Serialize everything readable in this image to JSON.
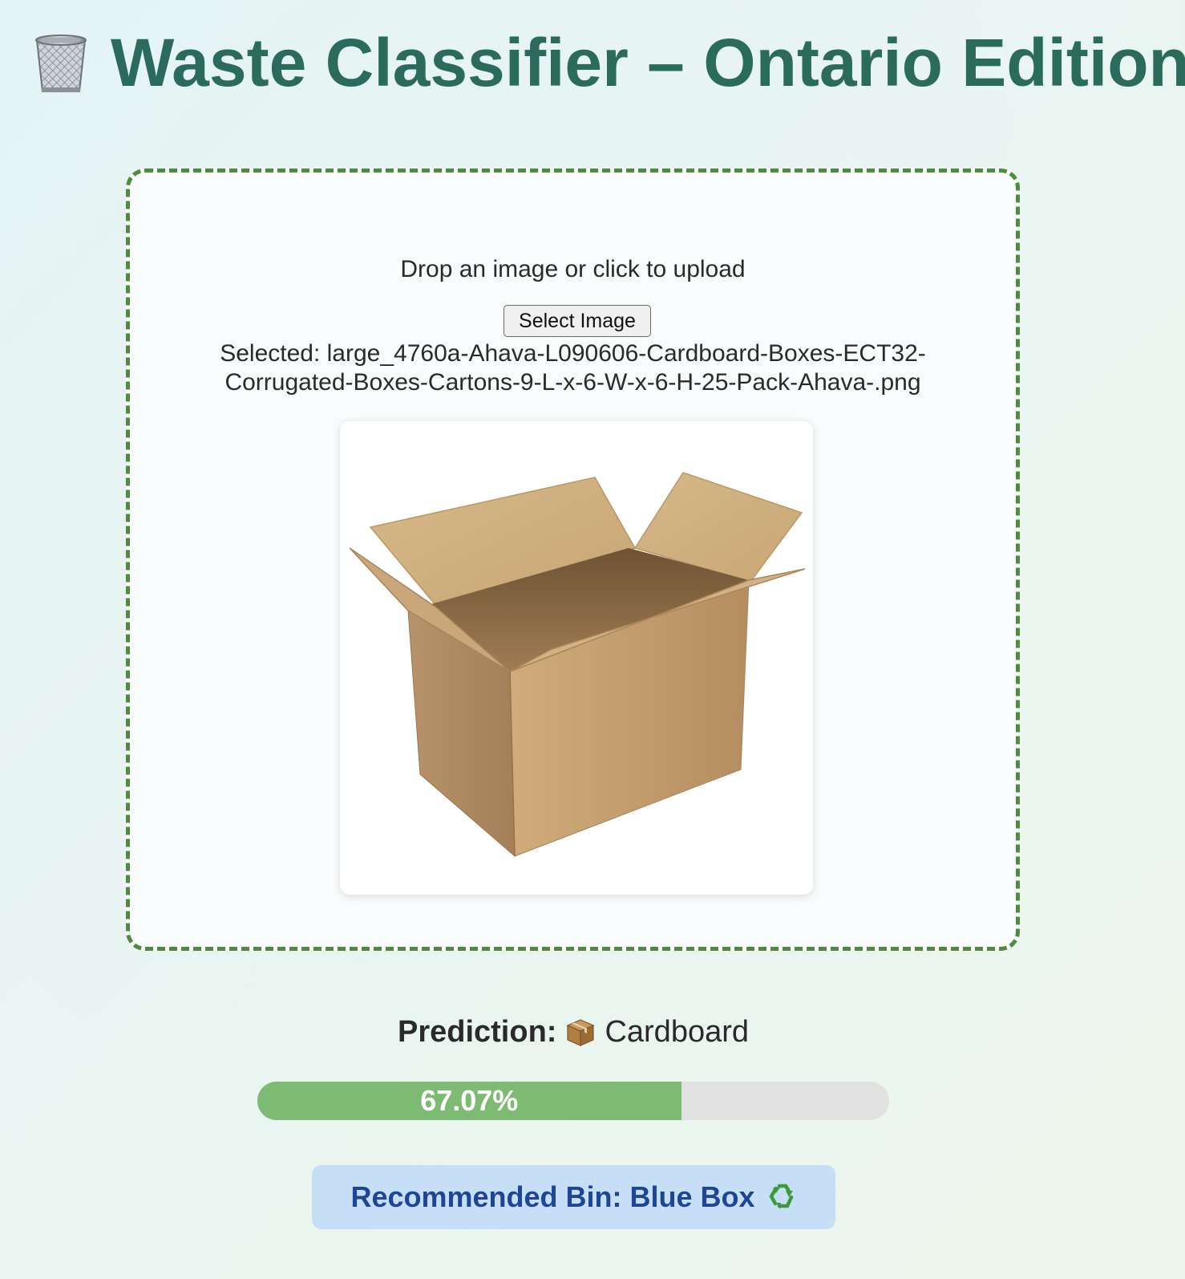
{
  "header": {
    "title": "Waste Classifier – Ontario Edition",
    "icon": "wastebasket-icon"
  },
  "upload": {
    "hint": "Drop an image or click to upload",
    "button_label": "Select Image",
    "selected_text": "Selected: large_4760a-Ahava-L090606-Cardboard-Boxes-ECT32-Corrugated-Boxes-Cartons-9-L-x-6-W-x-6-H-25-Pack-Ahava-.png",
    "preview_image": "open-cardboard-box"
  },
  "result": {
    "prediction_label": "Prediction:",
    "prediction_icon": "package-icon",
    "prediction_value": "Cardboard",
    "confidence_text": "67.07%",
    "confidence_percent": 67.07,
    "bin_text": "Recommended Bin: Blue Box",
    "bin_icon": "recycling-icon"
  },
  "colors": {
    "title": "#2b6b5c",
    "dropzone_border": "#4f8a3e",
    "progress_fill": "#7dba72",
    "progress_track": "#e1e1e1",
    "bin_background": "#c6dff6",
    "bin_text": "#1e4596"
  }
}
